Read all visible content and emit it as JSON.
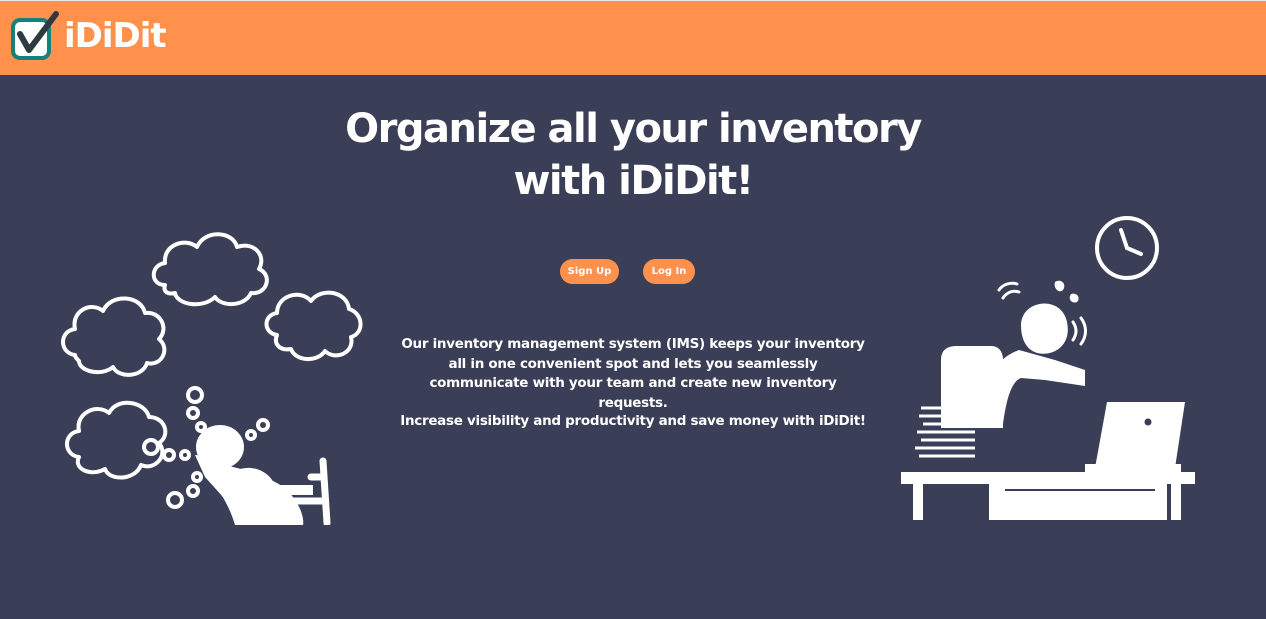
{
  "brand": {
    "name": "iDiDit",
    "accent_color": "#FF914D",
    "background_color": "#3B3E57",
    "logo_icon": "checkbox-check-icon"
  },
  "hero": {
    "headline_line1": "Organize all your inventory",
    "headline_line2": "with iDiDit!",
    "signup_label": "Sign Up",
    "login_label": "Log In",
    "description": "Our inventory management system (IMS) keeps your inventory all in one convenient spot and lets you seamlessly communicate with your team and create new inventory requests.",
    "tagline": "Increase visibility and productivity and save money with iDiDit!"
  },
  "illustrations": {
    "left_icon": "stressed-person-thinking-icon",
    "right_icon": "stressed-worker-at-desk-icon"
  }
}
